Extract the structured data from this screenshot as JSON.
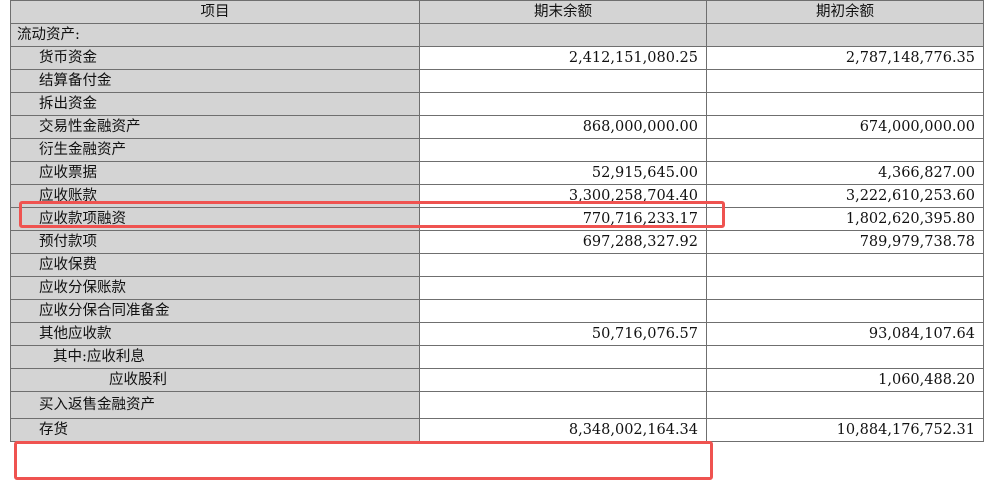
{
  "table": {
    "headers": [
      "项目",
      "期末余额",
      "期初余额"
    ],
    "rows": [
      {
        "item": "流动资产:",
        "end": "",
        "begin": "",
        "indent": 0,
        "section": true
      },
      {
        "item": "货币资金",
        "end": "2,412,151,080.25",
        "begin": "2,787,148,776.35",
        "indent": 1
      },
      {
        "item": "结算备付金",
        "end": "",
        "begin": "",
        "indent": 1
      },
      {
        "item": "拆出资金",
        "end": "",
        "begin": "",
        "indent": 1
      },
      {
        "item": "交易性金融资产",
        "end": "868,000,000.00",
        "begin": "674,000,000.00",
        "indent": 1
      },
      {
        "item": "衍生金融资产",
        "end": "",
        "begin": "",
        "indent": 1
      },
      {
        "item": "应收票据",
        "end": "52,915,645.00",
        "begin": "4,366,827.00",
        "indent": 1
      },
      {
        "item": "应收账款",
        "end": "3,300,258,704.40",
        "begin": "3,222,610,253.60",
        "indent": 1,
        "highlight": true
      },
      {
        "item": "应收款项融资",
        "end": "770,716,233.17",
        "begin": "1,802,620,395.80",
        "indent": 1
      },
      {
        "item": "预付款项",
        "end": "697,288,327.92",
        "begin": "789,979,738.78",
        "indent": 1
      },
      {
        "item": "应收保费",
        "end": "",
        "begin": "",
        "indent": 1
      },
      {
        "item": "应收分保账款",
        "end": "",
        "begin": "",
        "indent": 1
      },
      {
        "item": "应收分保合同准备金",
        "end": "",
        "begin": "",
        "indent": 1
      },
      {
        "item": "其他应收款",
        "end": "50,716,076.57",
        "begin": "93,084,107.64",
        "indent": 1
      },
      {
        "item": "其中:应收利息",
        "end": "",
        "begin": "",
        "indent": 2
      },
      {
        "item": "应收股利",
        "end": "",
        "begin": "1,060,488.20",
        "indent": 3
      },
      {
        "item": "买入返售金融资产",
        "end": "",
        "begin": "",
        "indent": 1,
        "clipped": true
      },
      {
        "item": "存货",
        "end": "8,348,002,164.34",
        "begin": "10,884,176,752.31",
        "indent": 1,
        "highlight": true
      }
    ]
  },
  "colors": {
    "header_bg": "#d4d4d4",
    "label_bg": "#d4d4d4",
    "border": "#6f6f6f",
    "highlight": "#ef5350"
  }
}
